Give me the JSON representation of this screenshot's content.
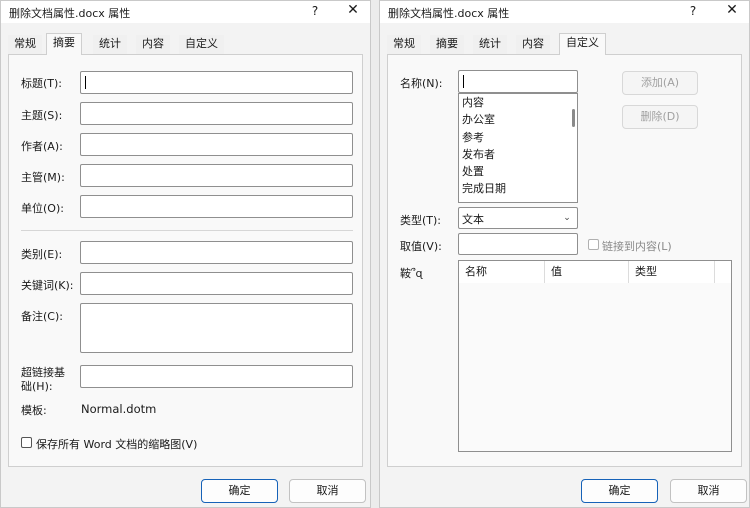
{
  "dialog_title": "删除文档属性.docx 属性",
  "help_glyph": "?",
  "close_glyph": "✕",
  "tabs": [
    "常规",
    "摘要",
    "统计",
    "内容",
    "自定义"
  ],
  "summary": {
    "title_label": "标题(T):",
    "subject_label": "主题(S):",
    "author_label": "作者(A):",
    "manager_label": "主管(M):",
    "company_label": "单位(O):",
    "category_label": "类别(E):",
    "keywords_label": "关键词(K):",
    "comments_label": "备注(C):",
    "hyperlink_label_1": "超链接基",
    "hyperlink_label_2": "础(H):",
    "template_label": "模板:",
    "template_value": "Normal.dotm",
    "thumbnail_label": "保存所有 Word 文档的缩略图(V)"
  },
  "custom": {
    "name_label": "名称(N):",
    "name_list": [
      "内容",
      "办公室",
      "参考",
      "发布者",
      "处置",
      "完成日期"
    ],
    "add_button": "添加(A)",
    "delete_button": "删除(D)",
    "type_label": "类型(T):",
    "type_value": "文本",
    "value_label": "取值(V):",
    "link_label": "链接到内容(L)",
    "props_label": "   ",
    "props_label_shown": "鞍՞ɋ",
    "grid_headers": [
      "名称",
      "值",
      "类型"
    ]
  },
  "buttons": {
    "ok": "确定",
    "cancel": "取消"
  }
}
